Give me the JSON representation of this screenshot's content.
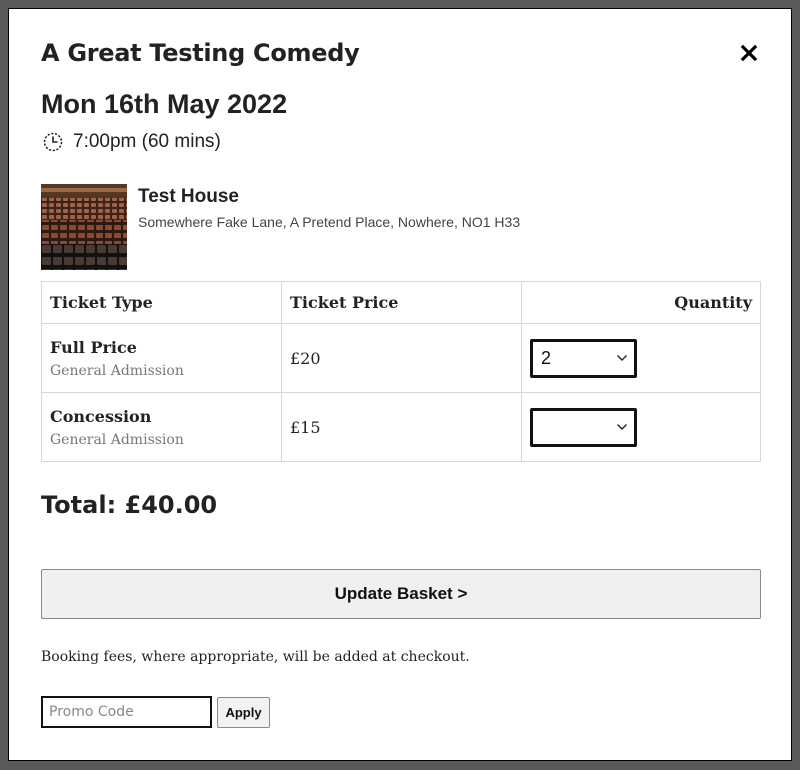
{
  "event": {
    "title": "A Great Testing Comedy",
    "date": "Mon 16th May 2022",
    "time": "7:00pm (60 mins)"
  },
  "icons": {
    "close": "close-icon",
    "clock": "clock-icon",
    "select_arrow": "chevron-down-icon"
  },
  "venue": {
    "name": "Test House",
    "address": "Somewhere Fake Lane, A Pretend Place, Nowhere, NO1 H33"
  },
  "table": {
    "headers": {
      "type": "Ticket Type",
      "price": "Ticket Price",
      "quantity": "Quantity"
    },
    "rows": [
      {
        "name": "Full Price",
        "sub": "General Admission",
        "price": "£20",
        "quantity": "2"
      },
      {
        "name": "Concession",
        "sub": "General Admission",
        "price": "£15",
        "quantity": ""
      }
    ]
  },
  "total": "Total: £40.00",
  "update_button": "Update Basket >",
  "fees_note": "Booking fees, where appropriate, will be added at checkout.",
  "promo": {
    "placeholder": "Promo Code",
    "value": "",
    "apply_label": "Apply"
  },
  "colors": {
    "overlay": "#5a5a5a",
    "modal_bg": "#ffffff",
    "text": "#222222",
    "subtext": "#777777",
    "table_border": "#d7d7d7",
    "button_bg": "#f0f0f0"
  }
}
